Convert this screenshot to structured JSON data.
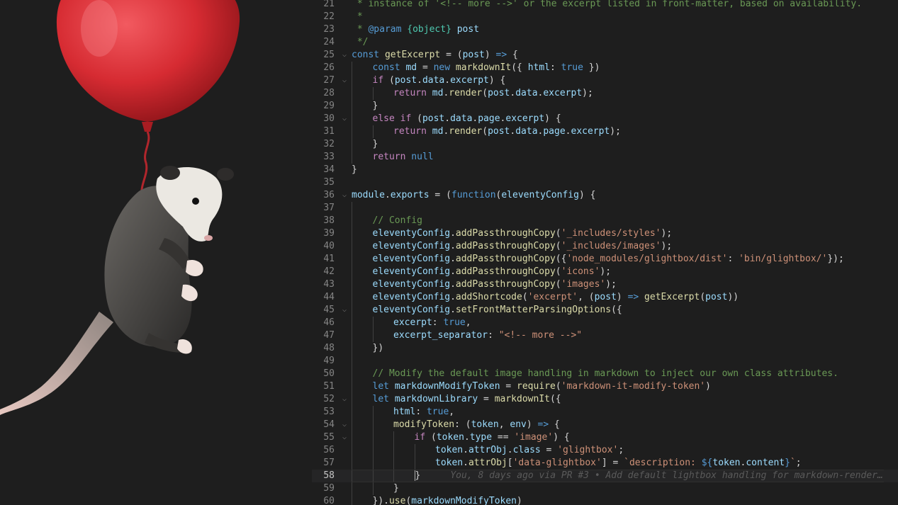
{
  "editor": {
    "current_line": 58,
    "blame_annotation": "You, 8 days ago via PR #3 • Add default lightbox handling for markdown-render…",
    "lines": [
      {
        "n": "21",
        "indent": 0,
        "tokens": [
          [
            "cm",
            " * instance of '<!-- more -->' or the excerpt listed in front-matter, based on availability."
          ]
        ]
      },
      {
        "n": "22",
        "indent": 0,
        "tokens": [
          [
            "cm",
            " *"
          ]
        ]
      },
      {
        "n": "23",
        "indent": 0,
        "tokens": [
          [
            "cm",
            " * "
          ],
          [
            "k",
            "@param"
          ],
          [
            "cm",
            " "
          ],
          [
            "t",
            "{object}"
          ],
          [
            "cm",
            " "
          ],
          [
            "v",
            "post"
          ]
        ]
      },
      {
        "n": "24",
        "indent": 0,
        "tokens": [
          [
            "cm",
            " */"
          ]
        ]
      },
      {
        "n": "25",
        "indent": 0,
        "fold": true,
        "tokens": [
          [
            "k",
            "const"
          ],
          [
            "b",
            " "
          ],
          [
            "f",
            "getExcerpt"
          ],
          [
            "b",
            " = ("
          ],
          [
            "v",
            "post"
          ],
          [
            "b",
            ") "
          ],
          [
            "k",
            "=>"
          ],
          [
            "b",
            " {"
          ]
        ]
      },
      {
        "n": "26",
        "indent": 1,
        "tokens": [
          [
            "k",
            "const"
          ],
          [
            "b",
            " "
          ],
          [
            "v",
            "md"
          ],
          [
            "b",
            " = "
          ],
          [
            "k",
            "new"
          ],
          [
            "b",
            " "
          ],
          [
            "f",
            "markdownIt"
          ],
          [
            "b",
            "({ "
          ],
          [
            "v",
            "html"
          ],
          [
            "b",
            ": "
          ],
          [
            "k",
            "true"
          ],
          [
            "b",
            " })"
          ]
        ]
      },
      {
        "n": "27",
        "indent": 1,
        "fold": true,
        "tokens": [
          [
            "c",
            "if"
          ],
          [
            "b",
            " ("
          ],
          [
            "v",
            "post"
          ],
          [
            "b",
            "."
          ],
          [
            "v",
            "data"
          ],
          [
            "b",
            "."
          ],
          [
            "v",
            "excerpt"
          ],
          [
            "b",
            ") {"
          ]
        ]
      },
      {
        "n": "28",
        "indent": 2,
        "tokens": [
          [
            "c",
            "return"
          ],
          [
            "b",
            " "
          ],
          [
            "v",
            "md"
          ],
          [
            "b",
            "."
          ],
          [
            "f",
            "render"
          ],
          [
            "b",
            "("
          ],
          [
            "v",
            "post"
          ],
          [
            "b",
            "."
          ],
          [
            "v",
            "data"
          ],
          [
            "b",
            "."
          ],
          [
            "v",
            "excerpt"
          ],
          [
            "b",
            ");"
          ]
        ]
      },
      {
        "n": "29",
        "indent": 1,
        "tokens": [
          [
            "b",
            "}"
          ]
        ]
      },
      {
        "n": "30",
        "indent": 1,
        "fold": true,
        "tokens": [
          [
            "c",
            "else"
          ],
          [
            "b",
            " "
          ],
          [
            "c",
            "if"
          ],
          [
            "b",
            " ("
          ],
          [
            "v",
            "post"
          ],
          [
            "b",
            "."
          ],
          [
            "v",
            "data"
          ],
          [
            "b",
            "."
          ],
          [
            "v",
            "page"
          ],
          [
            "b",
            "."
          ],
          [
            "v",
            "excerpt"
          ],
          [
            "b",
            ") {"
          ]
        ]
      },
      {
        "n": "31",
        "indent": 2,
        "tokens": [
          [
            "c",
            "return"
          ],
          [
            "b",
            " "
          ],
          [
            "v",
            "md"
          ],
          [
            "b",
            "."
          ],
          [
            "f",
            "render"
          ],
          [
            "b",
            "("
          ],
          [
            "v",
            "post"
          ],
          [
            "b",
            "."
          ],
          [
            "v",
            "data"
          ],
          [
            "b",
            "."
          ],
          [
            "v",
            "page"
          ],
          [
            "b",
            "."
          ],
          [
            "v",
            "excerpt"
          ],
          [
            "b",
            ");"
          ]
        ]
      },
      {
        "n": "32",
        "indent": 1,
        "tokens": [
          [
            "b",
            "}"
          ]
        ]
      },
      {
        "n": "33",
        "indent": 1,
        "tokens": [
          [
            "c",
            "return"
          ],
          [
            "b",
            " "
          ],
          [
            "k",
            "null"
          ]
        ]
      },
      {
        "n": "34",
        "indent": 0,
        "tokens": [
          [
            "b",
            "}"
          ]
        ]
      },
      {
        "n": "35",
        "indent": 0,
        "tokens": []
      },
      {
        "n": "36",
        "indent": 0,
        "fold": true,
        "tokens": [
          [
            "v",
            "module"
          ],
          [
            "b",
            "."
          ],
          [
            "v",
            "exports"
          ],
          [
            "b",
            " = ("
          ],
          [
            "k",
            "function"
          ],
          [
            "b",
            "("
          ],
          [
            "v",
            "eleventyConfig"
          ],
          [
            "b",
            ") {"
          ]
        ]
      },
      {
        "n": "37",
        "indent": 1,
        "tokens": []
      },
      {
        "n": "38",
        "indent": 1,
        "tokens": [
          [
            "cm",
            "// Config"
          ]
        ]
      },
      {
        "n": "39",
        "indent": 1,
        "tokens": [
          [
            "v",
            "eleventyConfig"
          ],
          [
            "b",
            "."
          ],
          [
            "f",
            "addPassthroughCopy"
          ],
          [
            "b",
            "("
          ],
          [
            "s",
            "'_includes/styles'"
          ],
          [
            "b",
            ");"
          ]
        ]
      },
      {
        "n": "40",
        "indent": 1,
        "tokens": [
          [
            "v",
            "eleventyConfig"
          ],
          [
            "b",
            "."
          ],
          [
            "f",
            "addPassthroughCopy"
          ],
          [
            "b",
            "("
          ],
          [
            "s",
            "'_includes/images'"
          ],
          [
            "b",
            ");"
          ]
        ]
      },
      {
        "n": "41",
        "indent": 1,
        "tokens": [
          [
            "v",
            "eleventyConfig"
          ],
          [
            "b",
            "."
          ],
          [
            "f",
            "addPassthroughCopy"
          ],
          [
            "b",
            "({"
          ],
          [
            "s",
            "'node_modules/glightbox/dist'"
          ],
          [
            "b",
            ": "
          ],
          [
            "s",
            "'bin/glightbox/'"
          ],
          [
            "b",
            "});"
          ]
        ]
      },
      {
        "n": "42",
        "indent": 1,
        "tokens": [
          [
            "v",
            "eleventyConfig"
          ],
          [
            "b",
            "."
          ],
          [
            "f",
            "addPassthroughCopy"
          ],
          [
            "b",
            "("
          ],
          [
            "s",
            "'icons'"
          ],
          [
            "b",
            ");"
          ]
        ]
      },
      {
        "n": "43",
        "indent": 1,
        "tokens": [
          [
            "v",
            "eleventyConfig"
          ],
          [
            "b",
            "."
          ],
          [
            "f",
            "addPassthroughCopy"
          ],
          [
            "b",
            "("
          ],
          [
            "s",
            "'images'"
          ],
          [
            "b",
            ");"
          ]
        ]
      },
      {
        "n": "44",
        "indent": 1,
        "tokens": [
          [
            "v",
            "eleventyConfig"
          ],
          [
            "b",
            "."
          ],
          [
            "f",
            "addShortcode"
          ],
          [
            "b",
            "("
          ],
          [
            "s",
            "'excerpt'"
          ],
          [
            "b",
            ", ("
          ],
          [
            "v",
            "post"
          ],
          [
            "b",
            ") "
          ],
          [
            "k",
            "=>"
          ],
          [
            "b",
            " "
          ],
          [
            "f",
            "getExcerpt"
          ],
          [
            "b",
            "("
          ],
          [
            "v",
            "post"
          ],
          [
            "b",
            "))"
          ]
        ]
      },
      {
        "n": "45",
        "indent": 1,
        "fold": true,
        "tokens": [
          [
            "v",
            "eleventyConfig"
          ],
          [
            "b",
            "."
          ],
          [
            "f",
            "setFrontMatterParsingOptions"
          ],
          [
            "b",
            "({"
          ]
        ]
      },
      {
        "n": "46",
        "indent": 2,
        "tokens": [
          [
            "v",
            "excerpt"
          ],
          [
            "b",
            ": "
          ],
          [
            "k",
            "true"
          ],
          [
            "b",
            ","
          ]
        ]
      },
      {
        "n": "47",
        "indent": 2,
        "tokens": [
          [
            "v",
            "excerpt_separator"
          ],
          [
            "b",
            ": "
          ],
          [
            "s",
            "\"<!-- more -->\""
          ]
        ]
      },
      {
        "n": "48",
        "indent": 1,
        "tokens": [
          [
            "b",
            "})"
          ]
        ]
      },
      {
        "n": "49",
        "indent": 1,
        "tokens": []
      },
      {
        "n": "50",
        "indent": 1,
        "tokens": [
          [
            "cm",
            "// Modify the default image handling in markdown to inject our own class attributes."
          ]
        ]
      },
      {
        "n": "51",
        "indent": 1,
        "tokens": [
          [
            "k",
            "let"
          ],
          [
            "b",
            " "
          ],
          [
            "v",
            "markdownModifyToken"
          ],
          [
            "b",
            " = "
          ],
          [
            "f",
            "require"
          ],
          [
            "b",
            "("
          ],
          [
            "s",
            "'markdown-it-modify-token'"
          ],
          [
            "b",
            ")"
          ]
        ]
      },
      {
        "n": "52",
        "indent": 1,
        "fold": true,
        "tokens": [
          [
            "k",
            "let"
          ],
          [
            "b",
            " "
          ],
          [
            "v",
            "markdownLibrary"
          ],
          [
            "b",
            " = "
          ],
          [
            "f",
            "markdownIt"
          ],
          [
            "b",
            "({"
          ]
        ]
      },
      {
        "n": "53",
        "indent": 2,
        "tokens": [
          [
            "v",
            "html"
          ],
          [
            "b",
            ": "
          ],
          [
            "k",
            "true"
          ],
          [
            "b",
            ","
          ]
        ]
      },
      {
        "n": "54",
        "indent": 2,
        "fold": true,
        "tokens": [
          [
            "f",
            "modifyToken"
          ],
          [
            "b",
            ": ("
          ],
          [
            "v",
            "token"
          ],
          [
            "b",
            ", "
          ],
          [
            "v",
            "env"
          ],
          [
            "b",
            ") "
          ],
          [
            "k",
            "=>"
          ],
          [
            "b",
            " {"
          ]
        ]
      },
      {
        "n": "55",
        "indent": 3,
        "fold": true,
        "tokens": [
          [
            "c",
            "if"
          ],
          [
            "b",
            " ("
          ],
          [
            "v",
            "token"
          ],
          [
            "b",
            "."
          ],
          [
            "v",
            "type"
          ],
          [
            "b",
            " == "
          ],
          [
            "s",
            "'image'"
          ],
          [
            "b",
            ") {"
          ]
        ]
      },
      {
        "n": "56",
        "indent": 4,
        "tokens": [
          [
            "v",
            "token"
          ],
          [
            "b",
            "."
          ],
          [
            "v",
            "attrObj"
          ],
          [
            "b",
            "."
          ],
          [
            "v",
            "class"
          ],
          [
            "b",
            " = "
          ],
          [
            "s",
            "'glightbox'"
          ],
          [
            "b",
            ";"
          ]
        ]
      },
      {
        "n": "57",
        "indent": 4,
        "tokens": [
          [
            "v",
            "token"
          ],
          [
            "b",
            "."
          ],
          [
            "f",
            "attrObj"
          ],
          [
            "b",
            "["
          ],
          [
            "s",
            "'data-glightbox'"
          ],
          [
            "b",
            "] = "
          ],
          [
            "s",
            "`description: "
          ],
          [
            "k",
            "${"
          ],
          [
            "v",
            "token"
          ],
          [
            "b",
            "."
          ],
          [
            "v",
            "content"
          ],
          [
            "k",
            "}"
          ],
          [
            "s",
            "`"
          ],
          [
            "b",
            ";"
          ]
        ]
      },
      {
        "n": "58",
        "indent": 3,
        "current": true,
        "tokens": [
          [
            "b",
            "}"
          ]
        ]
      },
      {
        "n": "59",
        "indent": 2,
        "tokens": [
          [
            "b",
            "}"
          ]
        ]
      },
      {
        "n": "60",
        "indent": 1,
        "tokens": [
          [
            "b",
            "})."
          ],
          [
            "f",
            "use"
          ],
          [
            "b",
            "("
          ],
          [
            "v",
            "markdownModifyToken"
          ],
          [
            "b",
            ")"
          ]
        ]
      }
    ]
  },
  "colors": {
    "background": "#1e1e1e",
    "balloon": "#d62b32",
    "opossum_fur": "#3f3d3b",
    "opossum_face": "#e9e6e0",
    "tail": "#c9a7a0"
  }
}
